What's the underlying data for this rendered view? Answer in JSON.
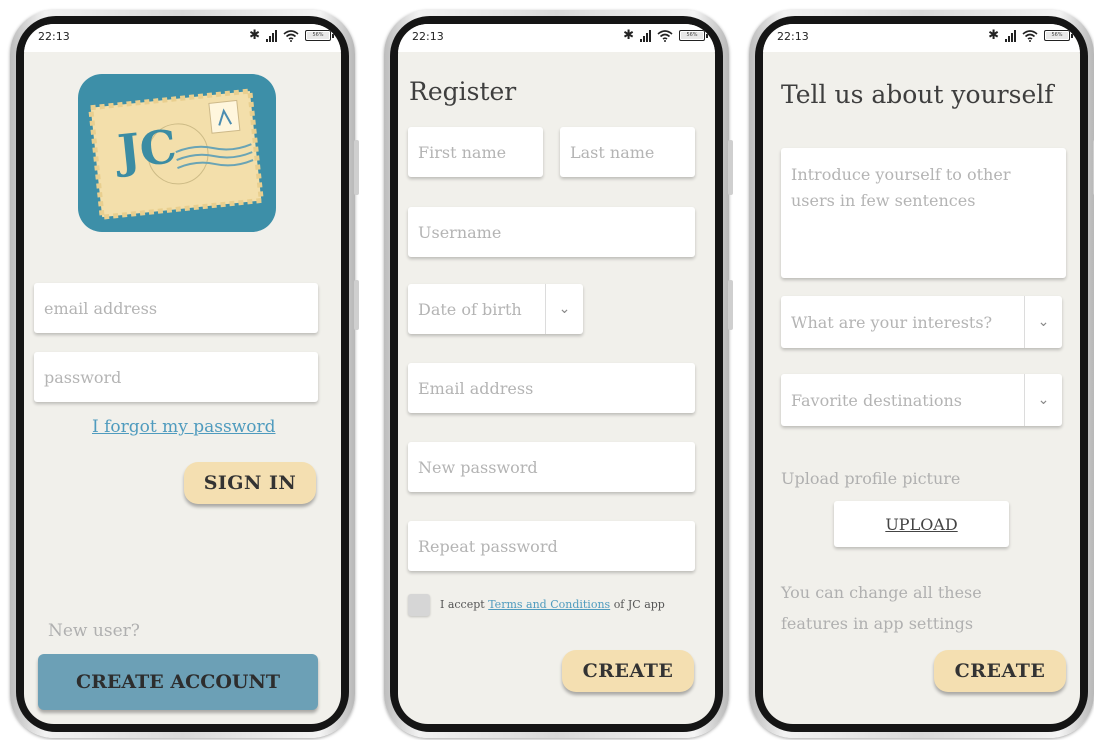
{
  "status": {
    "time": "22:13",
    "battery": "56%"
  },
  "login": {
    "logo_text": "JC",
    "email_placeholder": "email address",
    "password_placeholder": "password",
    "forgot_link": "I forgot my password",
    "sign_in": "SIGN IN",
    "new_user": "New user?",
    "create_account": "CREATE ACCOUNT"
  },
  "register": {
    "title": "Register",
    "first_name": "First name",
    "last_name": "Last name",
    "username": "Username",
    "dob": "Date of birth",
    "email": "Email address",
    "new_password": "New password",
    "repeat_password": "Repeat password",
    "terms_prefix": "I accept",
    "terms_link": "Terms and Conditions",
    "terms_suffix": "of JC app",
    "create": "CREATE"
  },
  "profile": {
    "title": "Tell us about yourself",
    "intro_placeholder": "Introduce yourself to other users in few sentences",
    "interests": "What are your interests?",
    "destinations": "Favorite destinations",
    "upload_label": "Upload profile picture",
    "upload_button": "UPLOAD",
    "note": "You can change all these features in app settings",
    "create": "CREATE"
  },
  "colors": {
    "screen_bg": "#f1f0eb",
    "gold_button": "#f4dfb1",
    "blue_button": "#6ca0b6",
    "link": "#4f9bbe",
    "logo_bg": "#3d8fa8"
  }
}
